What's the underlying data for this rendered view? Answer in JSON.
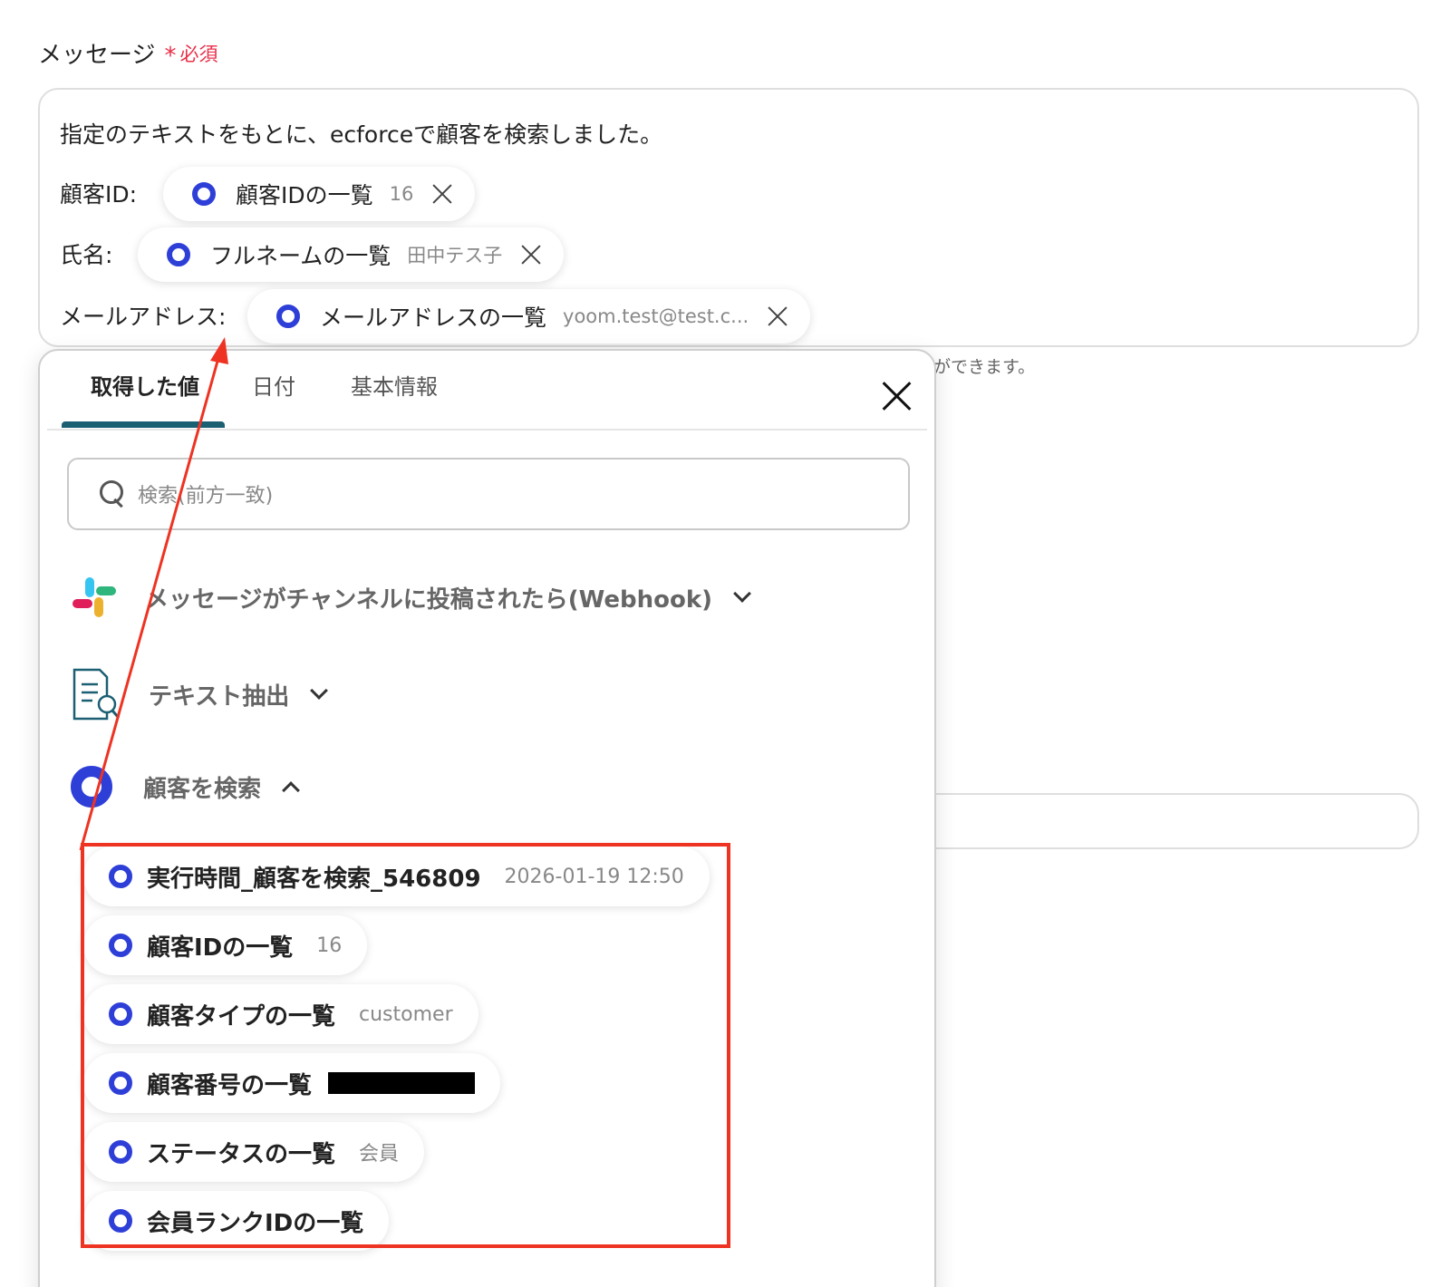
{
  "field": {
    "label": "メッセージ",
    "required_star": "*",
    "required_text": "必須"
  },
  "message": {
    "line1": "指定のテキストをもとに、ecforceで顧客を検索しました。",
    "rows": [
      {
        "label": "顧客ID:",
        "pill_name": "顧客IDの一覧",
        "pill_value": "16"
      },
      {
        "label": "氏名:",
        "pill_name": "フルネームの一覧",
        "pill_value": "田中テス子"
      },
      {
        "label": "メールアドレス:",
        "pill_name": "メールアドレスの一覧",
        "pill_value": "yoom.test@test.c..."
      }
    ]
  },
  "hint_text": "ができます。",
  "popup": {
    "tabs": [
      "取得した値",
      "日付",
      "基本情報"
    ],
    "active_tab": "取得した値",
    "search_placeholder": "検索(前方一致)",
    "sections": [
      {
        "title": "メッセージがチャンネルに投稿されたら(Webhook)",
        "icon": "slack-icon",
        "expanded": false
      },
      {
        "title": "テキスト抽出",
        "icon": "document-search-icon",
        "expanded": false
      },
      {
        "title": "顧客を検索",
        "icon": "ecforce-icon",
        "expanded": true
      }
    ],
    "options": [
      {
        "name": "実行時間_顧客を検索_546809",
        "value": "2026-01-19 12:50"
      },
      {
        "name": "顧客IDの一覧",
        "value": "16"
      },
      {
        "name": "顧客タイプの一覧",
        "value": "customer"
      },
      {
        "name": "顧客番号の一覧",
        "value": ""
      },
      {
        "name": "ステータスの一覧",
        "value": "会員"
      },
      {
        "name": "会員ランクIDの一覧",
        "value": ""
      }
    ]
  },
  "colors": {
    "accent_ring": "#2e3fd8",
    "required": "#e8304a",
    "tab_underline": "#1b5f73",
    "annotation": "#ee3322"
  }
}
